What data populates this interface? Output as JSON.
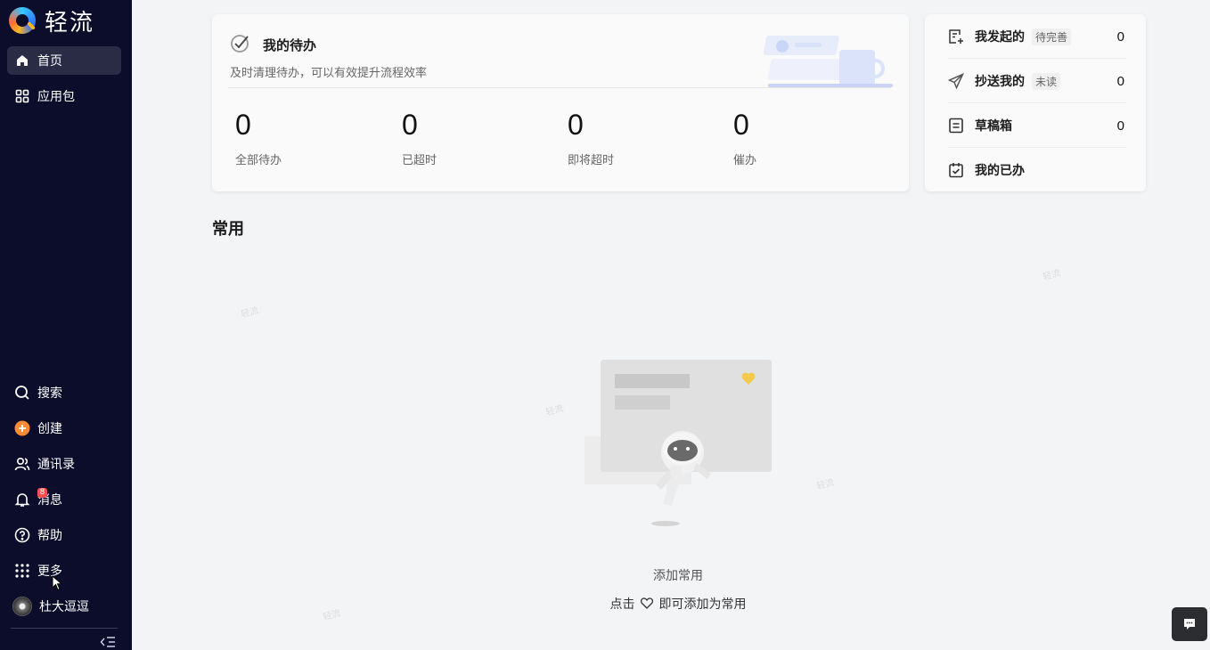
{
  "app": {
    "name": "轻流"
  },
  "sidebar": {
    "top_items": [
      {
        "label": "首页",
        "icon": "home-icon",
        "active": true
      },
      {
        "label": "应用包",
        "icon": "grid-icon",
        "active": false
      }
    ],
    "bottom_items": [
      {
        "label": "搜索",
        "icon": "search-icon"
      },
      {
        "label": "创建",
        "icon": "plus-circle-icon"
      },
      {
        "label": "通讯录",
        "icon": "contacts-icon"
      },
      {
        "label": "消息",
        "icon": "bell-icon",
        "badge": "8"
      },
      {
        "label": "帮助",
        "icon": "help-icon"
      },
      {
        "label": "更多",
        "icon": "apps-icon"
      }
    ],
    "user": {
      "name": "杜大逗逗"
    },
    "collapse_icon": "collapse-icon",
    "accent": "#ff8a34",
    "bg": "#0b0d2a"
  },
  "todo": {
    "title": "我的待办",
    "subtitle": "及时清理待办，可以有效提升流程效率",
    "stats": [
      {
        "value": "0",
        "label": "全部待办"
      },
      {
        "value": "0",
        "label": "已超时"
      },
      {
        "value": "0",
        "label": "即将超时"
      },
      {
        "value": "0",
        "label": "催办"
      }
    ]
  },
  "side_card": {
    "rows": [
      {
        "label": "我发起的",
        "tag": "待完善",
        "count": "0",
        "icon": "doc-plus-icon"
      },
      {
        "label": "抄送我的",
        "tag": "未读",
        "count": "0",
        "icon": "send-icon"
      },
      {
        "label": "草稿箱",
        "tag": "",
        "count": "0",
        "icon": "draft-icon"
      },
      {
        "label": "我的已办",
        "tag": "",
        "count": "",
        "icon": "calendar-check-icon"
      }
    ]
  },
  "common": {
    "section_title": "常用",
    "empty_title": "添加常用",
    "empty_hint_before": "点击",
    "empty_hint_after": "即可添加为常用"
  },
  "chat": {
    "icon": "chat-icon"
  }
}
